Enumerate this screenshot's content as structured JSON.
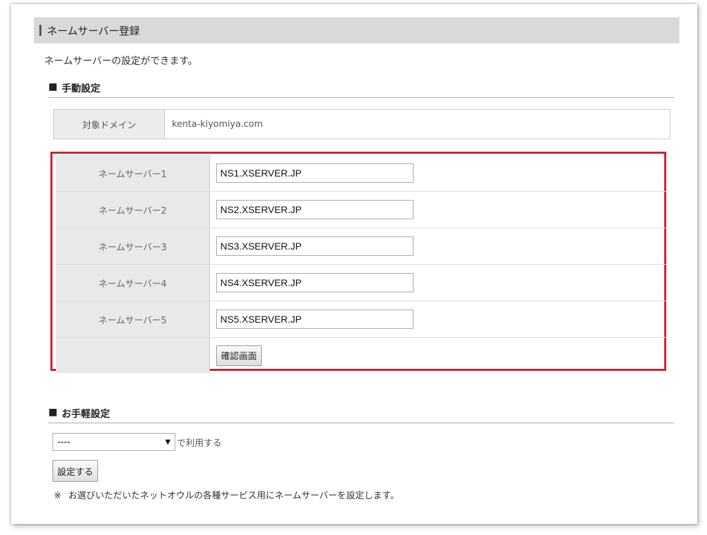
{
  "header": {
    "title": "ネームサーバー登録"
  },
  "intro": "ネームサーバーの設定ができます。",
  "manual": {
    "section_marker": "■",
    "title": "手動設定",
    "domain_label": "対象ドメイン",
    "domain_value": "kenta-kiyomiya.com",
    "nameservers": [
      {
        "label": "ネームサーバー1",
        "value": "NS1.XSERVER.JP"
      },
      {
        "label": "ネームサーバー2",
        "value": "NS2.XSERVER.JP"
      },
      {
        "label": "ネームサーバー3",
        "value": "NS3.XSERVER.JP"
      },
      {
        "label": "ネームサーバー4",
        "value": "NS4.XSERVER.JP"
      },
      {
        "label": "ネームサーバー5",
        "value": "NS5.XSERVER.JP"
      }
    ],
    "confirm_button": "確認画面",
    "highlight_color": "#cc2233"
  },
  "quick": {
    "section_marker": "■",
    "title": "お手軽設定",
    "select_value": "----",
    "select_icon": "triangle-down-icon",
    "select_suffix": "で利用する",
    "set_button": "設定する",
    "note_mark": "※",
    "note_text": "お選びいただいたネットオウルの各種サービス用にネームサーバーを設定します。"
  }
}
